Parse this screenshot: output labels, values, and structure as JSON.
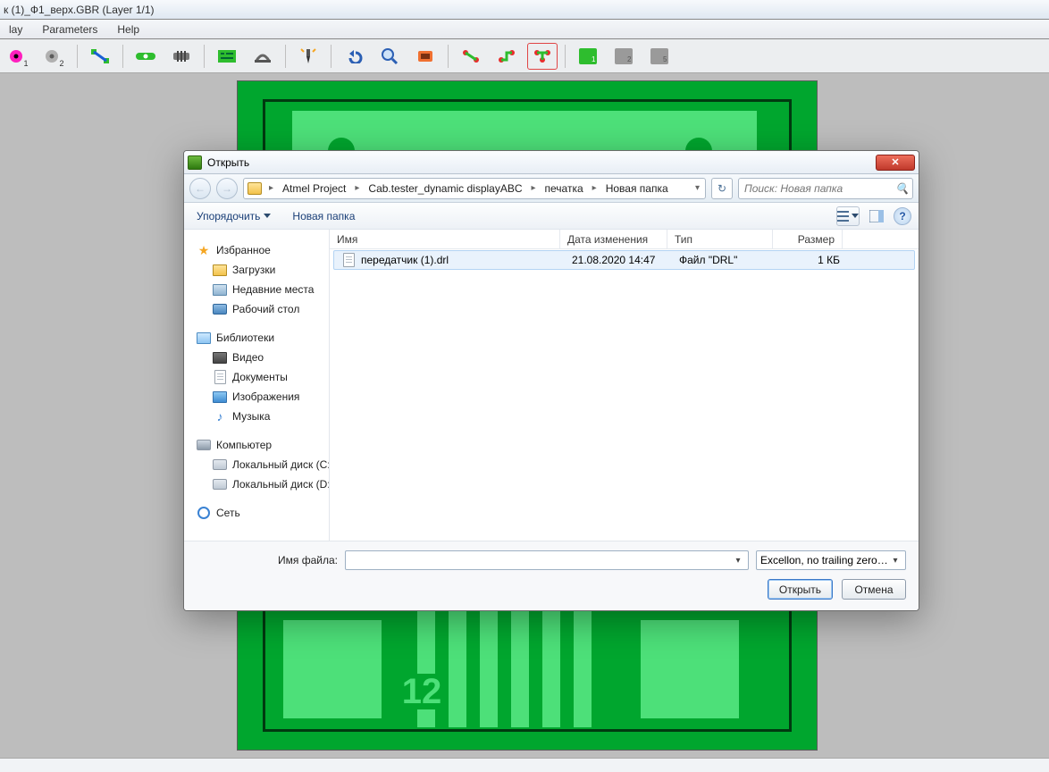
{
  "app": {
    "title": "к (1)_Ф1_верх.GBR   (Layer 1/1)",
    "menu": [
      "lay",
      "Parameters",
      "Help"
    ],
    "toolbar_subs": [
      "1",
      "2"
    ]
  },
  "dialog": {
    "title": "Открыть",
    "breadcrumbs": [
      "Atmel Project",
      "Cab.tester_dynamic displayABC",
      "печатка",
      "Новая папка"
    ],
    "search_placeholder": "Поиск: Новая папка",
    "toolbar": {
      "organize": "Упорядочить",
      "new_folder": "Новая папка"
    },
    "nav": {
      "favorites": {
        "title": "Избранное",
        "items": [
          "Загрузки",
          "Недавние места",
          "Рабочий стол"
        ]
      },
      "libraries": {
        "title": "Библиотеки",
        "items": [
          "Видео",
          "Документы",
          "Изображения",
          "Музыка"
        ]
      },
      "computer": {
        "title": "Компьютер",
        "items": [
          "Локальный диск (C:)",
          "Локальный диск (D:)"
        ]
      },
      "network": {
        "title": "Сеть"
      }
    },
    "columns": {
      "name": "Имя",
      "date": "Дата изменения",
      "type": "Тип",
      "size": "Размер"
    },
    "files": [
      {
        "name": "передатчик (1).drl",
        "date": "21.08.2020 14:47",
        "type": "Файл \"DRL\"",
        "size": "1 КБ"
      }
    ],
    "footer": {
      "filename_label": "Имя файла:",
      "filename_value": "",
      "filetype": "Excellon, no trailing zeros  (*.E..",
      "open": "Открыть",
      "cancel": "Отмена"
    }
  }
}
